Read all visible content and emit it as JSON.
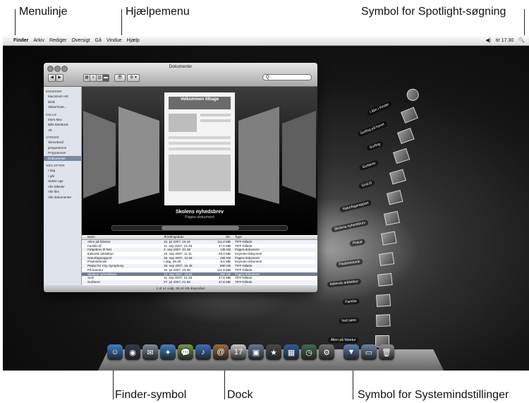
{
  "callouts": {
    "menubar": "Menulinje",
    "help_menu": "Hjælpemenu",
    "spotlight": "Symbol for Spotlight-søgning",
    "finder_symbol": "Finder-symbol",
    "dock": "Dock",
    "system_prefs": "Symbol for Systemindstillinger"
  },
  "menubar": {
    "apple": "",
    "items": [
      "Finder",
      "Arkiv",
      "Rediger",
      "Oversigt",
      "Gå",
      "Vindue",
      "Hjælp"
    ],
    "volume_icon": "◀)",
    "clock": "tir 17.30",
    "spotlight_icon": "🔍"
  },
  "finder": {
    "title": "Dokumenter",
    "toolbar": {
      "back": "◀",
      "forward": "▶",
      "view_icon": "▦",
      "view_list": "≡",
      "view_column": "▥",
      "view_coverflow": "▬",
      "quicklook": "👁",
      "action": "⚙ ▾"
    },
    "search_placeholder": "Q",
    "sidebar": {
      "sections": [
        {
          "title": "ENHEDER",
          "items": [
            "Macintosh HD",
            "iDisk",
            "Sikkerheds..."
          ]
        },
        {
          "title": "DELLE",
          "items": [
            "Mors Mac",
            "Bills MacBook",
            "Alt"
          ]
        },
        {
          "title": "STEDER",
          "items": [
            "Skrivebord",
            "jenspeterson",
            "Programmer",
            "Dokumenter"
          ]
        },
        {
          "title": "SØG EFTER",
          "items": [
            "I dag",
            "I går",
            "Sidste uge",
            "Alle billeder",
            "Alle film",
            "Alle dokumenter"
          ]
        }
      ],
      "selected": "Dokumenter"
    },
    "coverflow": {
      "center_doc_title": "Velkommen tilbage",
      "caption_title": "Skolens nyhedsbrev",
      "caption_sub": "Pages-dokument"
    },
    "columns": [
      "Navn",
      "Ændringsdato",
      "Str.",
      "Type"
    ],
    "rows": [
      [
        "Allen på fisketur",
        "16. jul 2007, 19.44",
        "111,8 MB",
        "TIFF-billede"
      ],
      [
        "Familie.tif",
        "11. sep 2007, 21.46",
        "47,6 MB",
        "TIFF-billede"
      ],
      [
        "Følgebrev til fest",
        "3. sep 2007, 01.48",
        "136 KB",
        "Pages-dokument"
      ],
      [
        "Italiensk arkitektur",
        "18. sep 2007, 11.11",
        "26,3 MB",
        "Keynote-dokument"
      ],
      [
        "Naturfagsrapport",
        "19. sep 2007, 12.55",
        "196 KB",
        "Pages-dokument"
      ],
      [
        "Pladetektonik",
        "I dag, 09.38",
        "5,5 MB",
        "Keynote-dokument"
      ],
      [
        "Plakat for City Symphony",
        "18. sep 2007, 16.45",
        "880 KB",
        "TIFF-billede"
      ],
      [
        "På kanotur",
        "16. jul 2007, 23.40",
        "111,8 MB",
        "TIFF-billede"
      ],
      [
        "Skolens nyhedsbrev",
        "13. sep 2007, 15.52",
        "280 KB",
        "Pages-dokument"
      ],
      [
        "Smil",
        "11. sep 2007, 21.46",
        "47,6 MB",
        "TIFF-billede"
      ],
      [
        "Surfærer",
        "27. jul 2007, 01.58",
        "47,6 MB",
        "TIFF-billede"
      ],
      [
        "Ved søen",
        "16. jul 2007, 23.42",
        "111,8 MB",
        "TIFF-billede"
      ]
    ],
    "selected_row": 8,
    "status": "1 af 14 valgt, 45,24 GB disponibel"
  },
  "stack": [
    "I åbn i Finder",
    "Surfing på havet",
    "Surfing",
    "Surfærer",
    "Smil.tif",
    "Naturfagsrapport",
    "Skolens nyhedsbrev",
    "Plakat",
    "Pladetektonik",
    "Italiensk arkitektur",
    "Familie",
    "Ved søen",
    "Allen på fisketur"
  ],
  "dock": {
    "icons": [
      {
        "name": "finder-icon",
        "glyph": "☺",
        "color": "#3b7fd6"
      },
      {
        "name": "dashboard-icon",
        "glyph": "◉",
        "color": "#34384a"
      },
      {
        "name": "mail-icon",
        "glyph": "✉",
        "color": "#7d8a99"
      },
      {
        "name": "safari-icon",
        "glyph": "✦",
        "color": "#3f80c7"
      },
      {
        "name": "ichat-icon",
        "glyph": "💬",
        "color": "#6f9a4b"
      },
      {
        "name": "itunes-icon",
        "glyph": "♪",
        "color": "#3a70c2"
      },
      {
        "name": "address-book-icon",
        "glyph": "@",
        "color": "#9b6b3b"
      },
      {
        "name": "ical-icon",
        "glyph": "17",
        "color": "#c8c8c8"
      },
      {
        "name": "iphoto-icon",
        "glyph": "▣",
        "color": "#627c96"
      },
      {
        "name": "imovie-icon",
        "glyph": "★",
        "color": "#4a4a4a"
      },
      {
        "name": "spaces-icon",
        "glyph": "▦",
        "color": "#2e5c9a"
      },
      {
        "name": "time-machine-icon",
        "glyph": "◷",
        "color": "#3f6a4f"
      },
      {
        "name": "system-preferences-icon",
        "glyph": "⚙",
        "color": "#707070"
      },
      {
        "name": "downloads-stack-icon",
        "glyph": "▼",
        "color": "#5a7fb3"
      },
      {
        "name": "documents-stack-icon",
        "glyph": "▭",
        "color": "#6b84a6"
      },
      {
        "name": "trash-icon",
        "glyph": "🗑",
        "color": "#8f8f8f"
      }
    ]
  }
}
